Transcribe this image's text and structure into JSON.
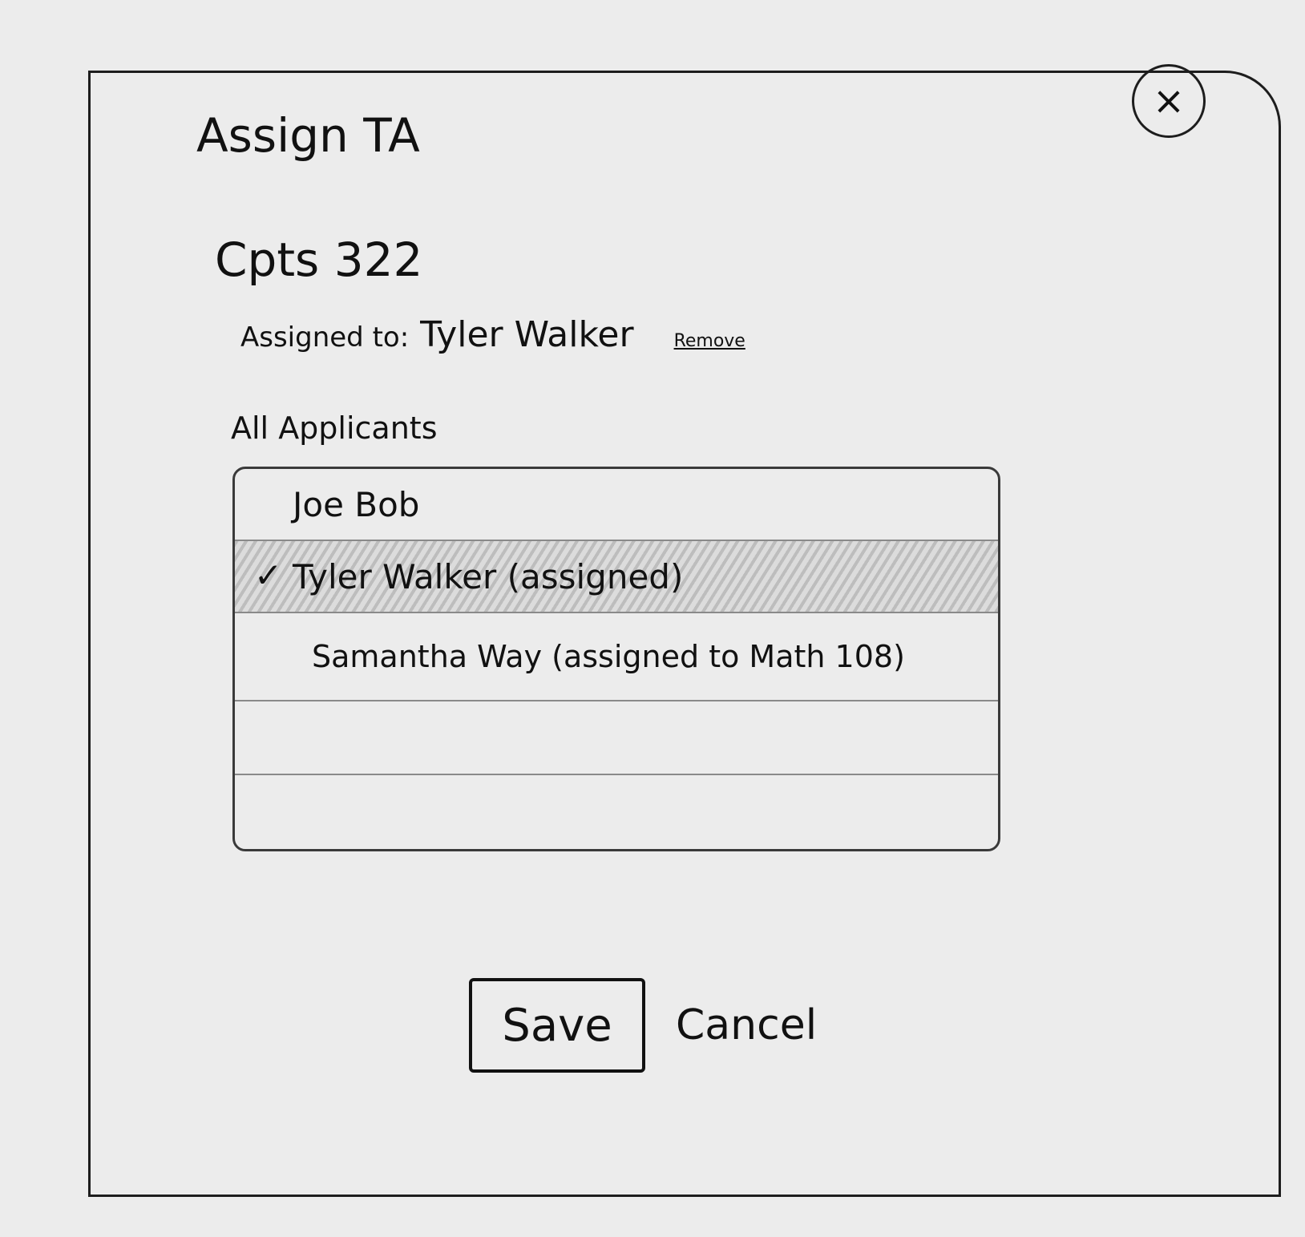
{
  "dialog": {
    "title": "Assign TA",
    "close_icon": "close-icon",
    "course": "Cpts 322",
    "assigned_label": "Assigned to:",
    "assigned_name": "Tyler Walker",
    "remove_label": "Remove",
    "applicants_label": "All Applicants",
    "applicants": [
      {
        "name": "Joe Bob",
        "selected": false
      },
      {
        "name": "Tyler Walker (assigned)",
        "selected": true,
        "check": "✓"
      },
      {
        "name": "Samantha Way (assigned to Math 108)",
        "selected": false
      }
    ],
    "save_label": "Save",
    "cancel_label": "Cancel"
  }
}
